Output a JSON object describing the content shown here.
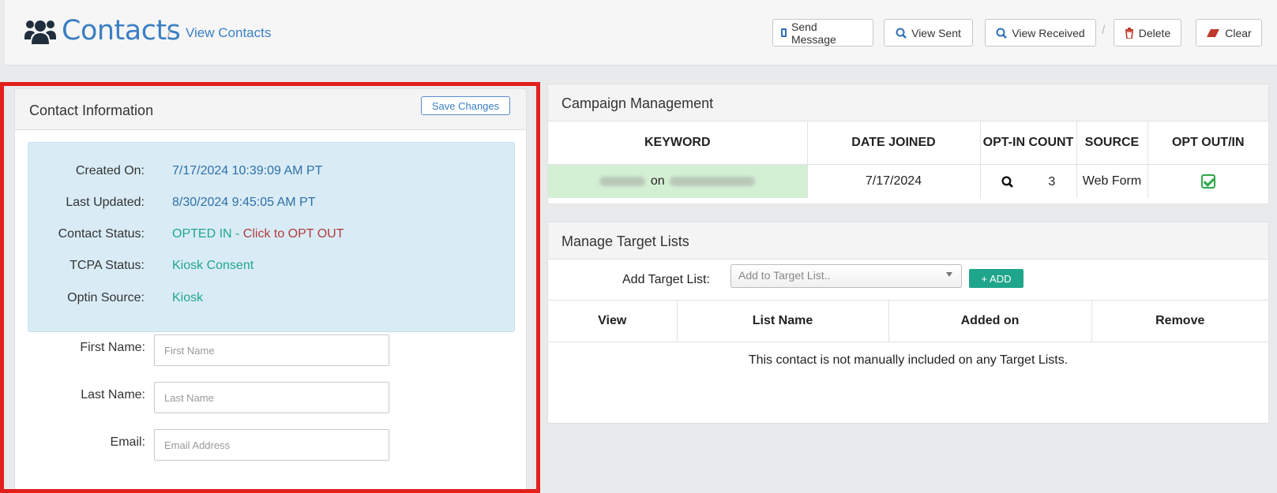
{
  "header": {
    "icon": "users-icon",
    "title": "Contacts",
    "breadcrumb_sep": "/",
    "breadcrumb": "View Contacts",
    "actions": {
      "send_message": {
        "label": "Send Message",
        "icon": "mobile-icon"
      },
      "view_sent": {
        "label": "View Sent",
        "icon": "search-icon"
      },
      "view_received": {
        "label": "View Received",
        "icon": "search-icon"
      },
      "separator": "/",
      "delete": {
        "label": "Delete",
        "icon": "trash-icon"
      },
      "clear": {
        "label": "Clear",
        "icon": "eraser-icon"
      }
    }
  },
  "contact_info": {
    "title": "Contact Information",
    "save_label": "Save Changes",
    "details": {
      "created_on_label": "Created On:",
      "created_on": "7/17/2024 10:39:09 AM PT",
      "last_updated_label": "Last Updated:",
      "last_updated": "8/30/2024 9:45:05 AM PT",
      "status_label": "Contact Status:",
      "status_value": "OPTED IN",
      "status_sep": " - ",
      "status_action": "Click to OPT OUT",
      "tcpa_label": "TCPA Status:",
      "tcpa_value": "Kiosk Consent",
      "optin_label": "Optin Source:",
      "optin_value": "Kiosk"
    },
    "fields": {
      "first_name_label": "First Name:",
      "first_name_placeholder": "First Name",
      "first_name_value": "",
      "last_name_label": "Last Name:",
      "last_name_placeholder": "Last Name",
      "last_name_value": "",
      "email_label": "Email:",
      "email_placeholder": "Email Address",
      "email_value": ""
    }
  },
  "campaign": {
    "title": "Campaign Management",
    "columns": [
      "KEYWORD",
      "DATE JOINED",
      "OPT-IN COUNT",
      "SOURCE",
      "OPT OUT/IN"
    ],
    "rows": [
      {
        "keyword_connector": "on",
        "date_joined": "7/17/2024",
        "optin_count": "3",
        "source": "Web Form",
        "opted_in": true
      }
    ]
  },
  "target_lists": {
    "title": "Manage Target Lists",
    "add_label": "Add Target List:",
    "select_placeholder": "Add to Target List..",
    "add_button": "+ ADD",
    "columns": [
      "View",
      "List Name",
      "Added on",
      "Remove"
    ],
    "empty_message": "This contact is not manually included on any Target Lists."
  },
  "colors": {
    "accent": "#3a7fc3",
    "info_box": "#d9ecf6",
    "opted_in": "#22a58e",
    "opt_out_link": "#b23a3a",
    "add_button": "#1fa58c",
    "highlight_outline": "#e2201d"
  }
}
